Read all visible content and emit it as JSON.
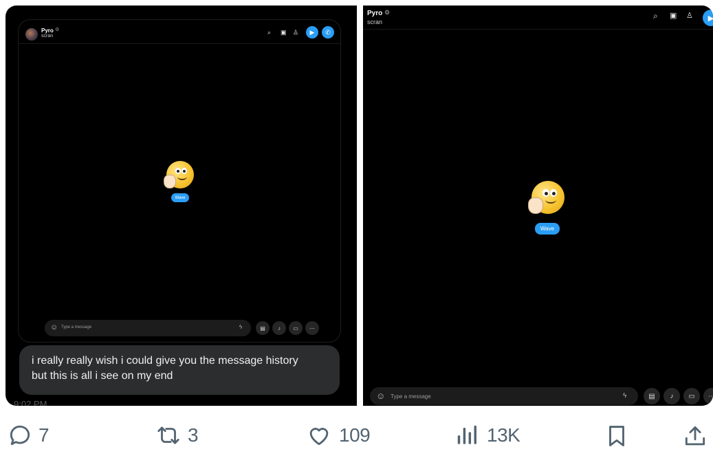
{
  "left_window": {
    "contact_name": "Pyro",
    "contact_status": "scran",
    "reaction_label": "Wave",
    "composer_placeholder": "Type a message"
  },
  "message_bubble": {
    "line1": "i really really wish i could give you the message history",
    "line2": "but this is all i see on my end"
  },
  "timestamp_partial": "9:02 PM",
  "right_window": {
    "contact_name": "Pyro",
    "contact_status": "scran",
    "reaction_label": "Wave",
    "composer_placeholder": "Type a message"
  },
  "actions": {
    "replies": "7",
    "reposts": "3",
    "likes": "109",
    "views": "13K"
  },
  "colors": {
    "accent": "#2a9df4",
    "action_gray": "#536471",
    "panel_bg": "#000000",
    "bubble_bg": "#2b2d2e"
  },
  "icons": [
    "reply-icon",
    "repost-icon",
    "like-icon",
    "views-icon",
    "bookmark-icon",
    "share-icon",
    "search-icon",
    "gallery-icon",
    "add-contact-icon",
    "video-call-icon",
    "audio-call-icon",
    "emoji-icon",
    "giphy-icon",
    "file-icon",
    "mic-icon",
    "contact-card-icon",
    "more-icon"
  ]
}
